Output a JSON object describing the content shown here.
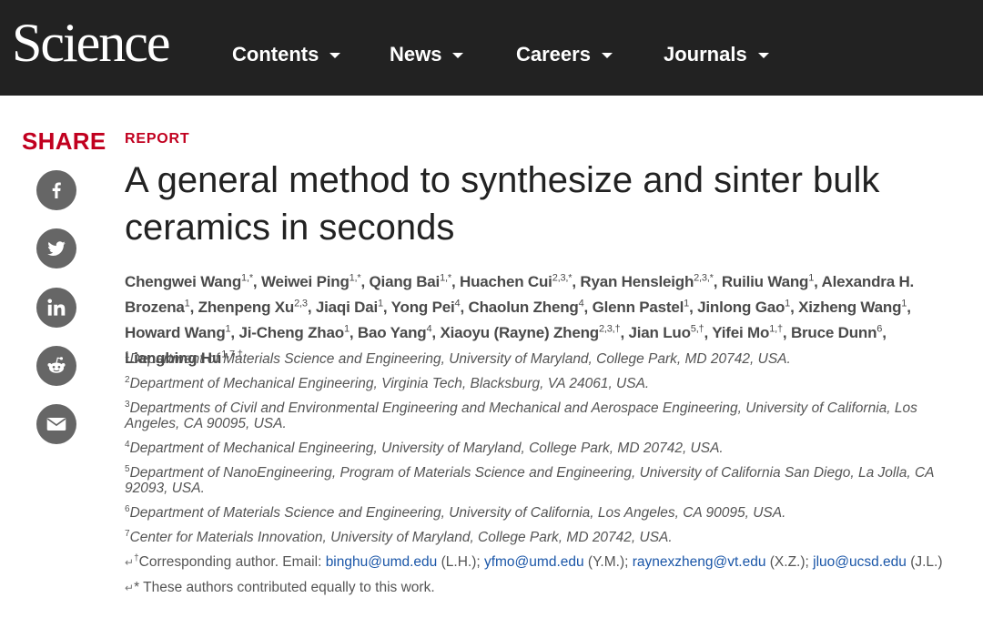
{
  "header": {
    "logo": "Science",
    "nav": [
      {
        "label": "Contents"
      },
      {
        "label": "News"
      },
      {
        "label": "Careers"
      },
      {
        "label": "Journals"
      }
    ]
  },
  "share": {
    "label": "SHARE",
    "buttons": [
      {
        "icon": "facebook-icon"
      },
      {
        "icon": "twitter-icon"
      },
      {
        "icon": "linkedin-icon"
      },
      {
        "icon": "reddit-icon"
      },
      {
        "icon": "email-icon"
      }
    ]
  },
  "article": {
    "kicker": "REPORT",
    "title": "A general method to synthesize and sinter bulk ceramics in seconds",
    "authors": [
      {
        "name": "Chengwei Wang",
        "sup": "1,*"
      },
      {
        "name": "Weiwei Ping",
        "sup": "1,*"
      },
      {
        "name": "Qiang Bai",
        "sup": "1,*"
      },
      {
        "name": "Huachen Cui",
        "sup": "2,3,*"
      },
      {
        "name": "Ryan Hensleigh",
        "sup": "2,3,*"
      },
      {
        "name": "Ruiliu Wang",
        "sup": "1"
      },
      {
        "name": "Alexandra H. Brozena",
        "sup": "1"
      },
      {
        "name": "Zhenpeng Xu",
        "sup": "2,3"
      },
      {
        "name": "Jiaqi Dai",
        "sup": "1"
      },
      {
        "name": "Yong Pei",
        "sup": "4"
      },
      {
        "name": "Chaolun Zheng",
        "sup": "4"
      },
      {
        "name": "Glenn Pastel",
        "sup": "1"
      },
      {
        "name": "Jinlong Gao",
        "sup": "1"
      },
      {
        "name": "Xizheng Wang",
        "sup": "1"
      },
      {
        "name": "Howard Wang",
        "sup": "1"
      },
      {
        "name": "Ji-Cheng Zhao",
        "sup": "1"
      },
      {
        "name": "Bao Yang",
        "sup": "4"
      },
      {
        "name": "Xiaoyu (Rayne) Zheng",
        "sup": "2,3,†"
      },
      {
        "name": "Jian Luo",
        "sup": "5,†"
      },
      {
        "name": "Yifei Mo",
        "sup": "1,†"
      },
      {
        "name": "Bruce Dunn",
        "sup": "6"
      },
      {
        "name": "Liangbing Hu",
        "sup": "1,7,†"
      }
    ],
    "affiliations": [
      {
        "sup": "1",
        "text": "Department of Materials Science and Engineering, University of Maryland, College Park, MD 20742, USA."
      },
      {
        "sup": "2",
        "text": "Department of Mechanical Engineering, Virginia Tech, Blacksburg, VA 24061, USA."
      },
      {
        "sup": "3",
        "text": "Departments of Civil and Environmental Engineering and Mechanical and Aerospace Engineering, University of California, Los Angeles, CA 90095, USA."
      },
      {
        "sup": "4",
        "text": "Department of Mechanical Engineering, University of Maryland, College Park, MD 20742, USA."
      },
      {
        "sup": "5",
        "text": "Department of NanoEngineering, Program of Materials Science and Engineering, University of California San Diego, La Jolla, CA 92093, USA."
      },
      {
        "sup": "6",
        "text": "Department of Materials Science and Engineering, University of California, Los Angeles, CA 90095, USA."
      },
      {
        "sup": "7",
        "text": "Center for Materials Innovation, University of Maryland, College Park, MD 20742, USA."
      }
    ],
    "correspondence": {
      "return_glyph": "↵",
      "sup": "†",
      "prefix": "Corresponding author. Email: ",
      "emails": [
        {
          "address": "binghu@umd.edu",
          "initials": " (L.H.); "
        },
        {
          "address": "yfmo@umd.edu",
          "initials": " (Y.M.); "
        },
        {
          "address": "raynexzheng@vt.edu",
          "initials": " (X.Z.); "
        },
        {
          "address": "jluo@ucsd.edu",
          "initials": " (J.L.)"
        }
      ]
    },
    "equal_note": {
      "return_glyph": "↵",
      "text": "* These authors contributed equally to this work."
    }
  },
  "colors": {
    "header_bg": "#222222",
    "accent_red": "#c1001f",
    "share_icon_bg": "#666666",
    "link_blue": "#1a56a8"
  }
}
